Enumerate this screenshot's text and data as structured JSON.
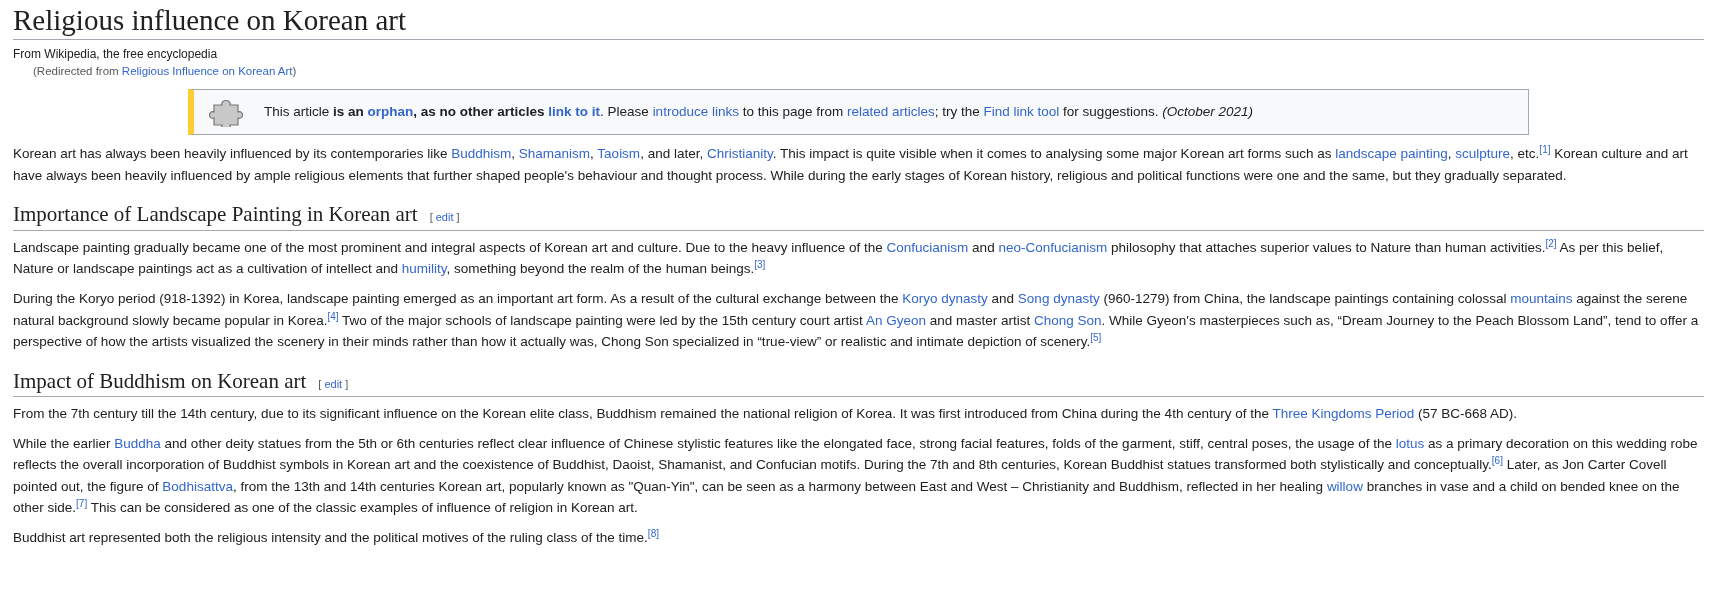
{
  "title": "Religious influence on Korean art",
  "tagline": "From Wikipedia, the free encyclopedia",
  "redirect": [
    {
      "kind": "text",
      "t": "(Redirected from "
    },
    {
      "kind": "link",
      "t": "Religious Influence on Korean Art"
    },
    {
      "kind": "text",
      "t": ")"
    }
  ],
  "notice": [
    {
      "kind": "text",
      "t": "This article "
    },
    {
      "kind": "bold",
      "t": "is an "
    },
    {
      "kind": "bold_link",
      "t": "orphan"
    },
    {
      "kind": "bold",
      "t": ", as no other articles "
    },
    {
      "kind": "bold_link",
      "t": "link to it"
    },
    {
      "kind": "text",
      "t": ". Please "
    },
    {
      "kind": "link",
      "t": "introduce links"
    },
    {
      "kind": "text",
      "t": " to this page from "
    },
    {
      "kind": "link",
      "t": "related articles"
    },
    {
      "kind": "text",
      "t": "; try the "
    },
    {
      "kind": "link",
      "t": "Find link tool"
    },
    {
      "kind": "text",
      "t": " for suggestions. "
    },
    {
      "kind": "italic",
      "t": "(October 2021)"
    }
  ],
  "sections": [
    {
      "paragraphs": [
        [
          {
            "kind": "text",
            "t": "Korean art has always been heavily influenced by its contemporaries like "
          },
          {
            "kind": "link",
            "t": "Buddhism"
          },
          {
            "kind": "text",
            "t": ", "
          },
          {
            "kind": "link",
            "t": "Shamanism"
          },
          {
            "kind": "text",
            "t": ", "
          },
          {
            "kind": "link",
            "t": "Taoism"
          },
          {
            "kind": "text",
            "t": ", and later, "
          },
          {
            "kind": "link",
            "t": "Christianity"
          },
          {
            "kind": "text",
            "t": ". This impact is quite visible when it comes to analysing some major Korean art forms such as "
          },
          {
            "kind": "link",
            "t": "landscape painting"
          },
          {
            "kind": "text",
            "t": ", "
          },
          {
            "kind": "link",
            "t": "sculpture"
          },
          {
            "kind": "text",
            "t": ", etc."
          },
          {
            "kind": "ref",
            "t": "[1]"
          },
          {
            "kind": "text",
            "t": " Korean culture and art have always been heavily influenced by ample religious elements that further shaped people's behaviour and thought process. While during the early stages of Korean history, religious and political functions were one and the same, but they gradually separated."
          }
        ]
      ]
    },
    {
      "heading": "Importance of Landscape Painting in Korean art",
      "edit": {
        "open": "[",
        "label": "edit",
        "close": "]"
      },
      "paragraphs": [
        [
          {
            "kind": "text",
            "t": "Landscape painting gradually became one of the most prominent and integral aspects of Korean art and culture. Due to the heavy influence of the "
          },
          {
            "kind": "link",
            "t": "Confucianism"
          },
          {
            "kind": "text",
            "t": " and "
          },
          {
            "kind": "link",
            "t": "neo-Confucianism"
          },
          {
            "kind": "text",
            "t": " philosophy that attaches superior values to Nature than human activities."
          },
          {
            "kind": "ref",
            "t": "[2]"
          },
          {
            "kind": "text",
            "t": " As per this belief, Nature or landscape paintings act as a cultivation of intellect and "
          },
          {
            "kind": "link",
            "t": "humility"
          },
          {
            "kind": "text",
            "t": ", something beyond the realm of the human beings."
          },
          {
            "kind": "ref",
            "t": "[3]"
          }
        ],
        [
          {
            "kind": "text",
            "t": "During the Koryo period (918-1392) in Korea, landscape painting emerged as an important art form. As a result of the cultural exchange between the "
          },
          {
            "kind": "link",
            "t": "Koryo dynasty"
          },
          {
            "kind": "text",
            "t": " and "
          },
          {
            "kind": "link",
            "t": "Song dynasty"
          },
          {
            "kind": "text",
            "t": " (960-1279) from China, the landscape paintings containing colossal "
          },
          {
            "kind": "link",
            "t": "mountains"
          },
          {
            "kind": "text",
            "t": " against the serene natural background slowly became popular in Korea."
          },
          {
            "kind": "ref",
            "t": "[4]"
          },
          {
            "kind": "text",
            "t": " Two of the major schools of landscape painting were led by the 15th century court artist "
          },
          {
            "kind": "link",
            "t": "An Gyeon"
          },
          {
            "kind": "text",
            "t": " and master artist "
          },
          {
            "kind": "link",
            "t": "Chong Son"
          },
          {
            "kind": "text",
            "t": ". While Gyeon's masterpieces such as, “Dream Journey to the Peach Blossom Land”, tend to offer a perspective of how the artists visualized the scenery in their minds rather than how it actually was, Chong Son specialized in “true-view” or realistic and intimate depiction of scenery."
          },
          {
            "kind": "ref",
            "t": "[5]"
          }
        ]
      ]
    },
    {
      "heading": "Impact of Buddhism on Korean art",
      "edit": {
        "open": "[",
        "label": "edit",
        "close": "]"
      },
      "paragraphs": [
        [
          {
            "kind": "text",
            "t": "From the 7th century till the 14th century, due to its significant influence on the Korean elite class, Buddhism remained the national religion of Korea. It was first introduced from China during the 4th century of the "
          },
          {
            "kind": "link",
            "t": "Three Kingdoms Period"
          },
          {
            "kind": "text",
            "t": " (57 BC-668 AD)."
          }
        ],
        [
          {
            "kind": "text",
            "t": "While the earlier "
          },
          {
            "kind": "link",
            "t": "Buddha"
          },
          {
            "kind": "text",
            "t": " and other deity statues from the 5th or 6th centuries reflect clear influence of Chinese stylistic features like the elongated face, strong facial features, folds of the garment, stiff, central poses, the usage of the "
          },
          {
            "kind": "link",
            "t": "lotus"
          },
          {
            "kind": "text",
            "t": " as a primary decoration on this wedding robe reflects the overall incorporation of Buddhist symbols in Korean art and the coexistence of Buddhist, Daoist, Shamanist, and Confucian motifs. During the 7th and 8th centuries, Korean Buddhist statues transformed both stylistically and conceptually."
          },
          {
            "kind": "ref",
            "t": "[6]"
          },
          {
            "kind": "text",
            "t": " Later, as Jon Carter Covell pointed out, the figure of "
          },
          {
            "kind": "link",
            "t": "Bodhisattva"
          },
          {
            "kind": "text",
            "t": ", from the 13th and 14th centuries Korean art, popularly known as \"Quan-Yin\", can be seen as a harmony between East and West – Christianity and Buddhism, reflected in her healing "
          },
          {
            "kind": "link",
            "t": "willow"
          },
          {
            "kind": "text",
            "t": " branches in vase and a child on bended knee on the other side."
          },
          {
            "kind": "ref",
            "t": "[7]"
          },
          {
            "kind": "text",
            "t": " This can be considered as one of the classic examples of influence of religion in Korean art."
          }
        ],
        [
          {
            "kind": "text",
            "t": "Buddhist art represented both the religious intensity and the political motives of the ruling class of the time."
          },
          {
            "kind": "ref",
            "t": "[8]"
          }
        ]
      ]
    }
  ]
}
